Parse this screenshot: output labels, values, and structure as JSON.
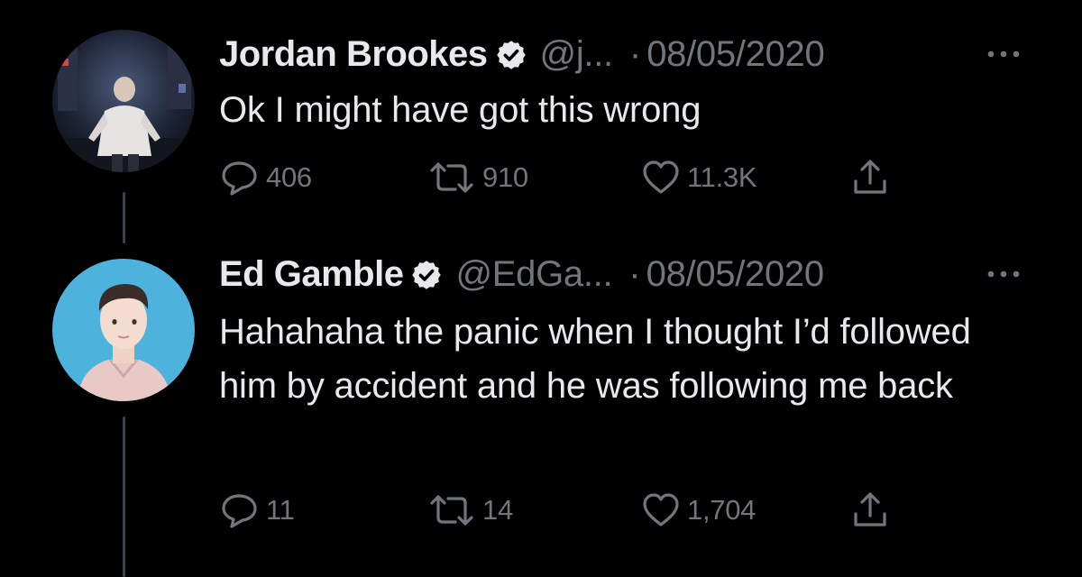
{
  "thread": {
    "tweets": [
      {
        "author_name": "Jordan Brookes",
        "handle": "@j...",
        "separator": "·",
        "date": "08/05/2020",
        "text": "Ok I might have got this wrong",
        "reply_count": "406",
        "retweet_count": "910",
        "like_count": "11.3K"
      },
      {
        "author_name": "Ed Gamble",
        "handle": "@EdGa...",
        "separator": "·",
        "date": "08/05/2020",
        "text": "Hahahaha the panic when I thought I’d followed him by accident and he was following me back",
        "reply_count": "11",
        "retweet_count": "14",
        "like_count": "1,704"
      }
    ]
  },
  "icons": {
    "verified": "verified-badge-icon",
    "more": "more-options-icon",
    "reply": "reply-icon",
    "retweet": "retweet-icon",
    "like": "like-icon",
    "share": "share-icon"
  },
  "colors": {
    "background": "#000000",
    "primary_text": "#e7e9ea",
    "secondary_text": "#71767b",
    "thread_line": "#38444d"
  }
}
